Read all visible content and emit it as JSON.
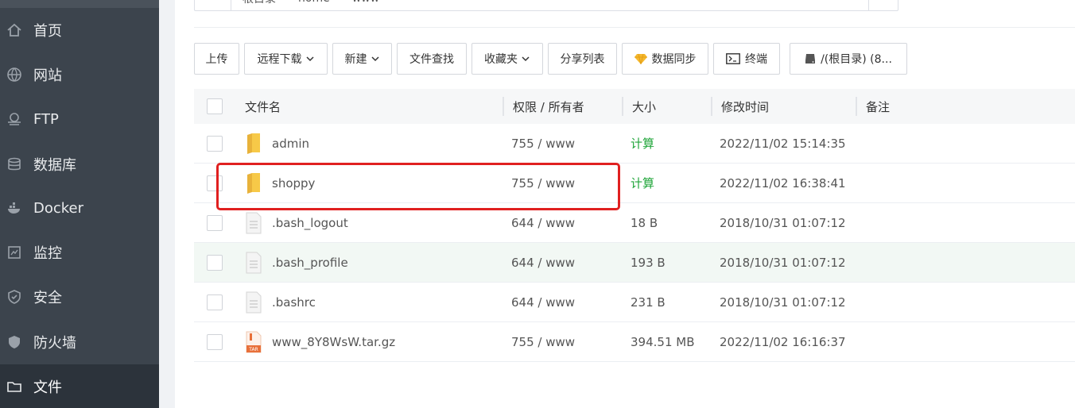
{
  "sidebar": {
    "items": [
      {
        "label": "首页",
        "icon": "home-icon"
      },
      {
        "label": "网站",
        "icon": "globe-icon"
      },
      {
        "label": "FTP",
        "icon": "ftp-icon"
      },
      {
        "label": "数据库",
        "icon": "database-icon"
      },
      {
        "label": "Docker",
        "icon": "docker-icon"
      },
      {
        "label": "监控",
        "icon": "monitor-icon"
      },
      {
        "label": "安全",
        "icon": "shield-icon"
      },
      {
        "label": "防火墙",
        "icon": "firewall-icon"
      },
      {
        "label": "文件",
        "icon": "folder-icon",
        "active": true
      }
    ]
  },
  "path": {
    "segments": [
      "根目录",
      "home",
      "www"
    ]
  },
  "toolbar": {
    "upload": "上传",
    "remote_download": "远程下载",
    "new": "新建",
    "file_search": "文件查找",
    "favorites": "收藏夹",
    "share_list": "分享列表",
    "data_sync": "数据同步",
    "terminal": "终端",
    "disk": "/(根目录) (8..."
  },
  "table": {
    "headers": {
      "name": "文件名",
      "perm": "权限 / 所有者",
      "size": "大小",
      "time": "修改时间",
      "note": "备注"
    },
    "rows": [
      {
        "name": "admin",
        "type": "folder",
        "perm": "755 / www",
        "size": "计算",
        "time": "2022/11/02 15:14:35"
      },
      {
        "name": "shoppy",
        "type": "folder",
        "perm": "755 / www",
        "size": "计算",
        "time": "2022/11/02 16:38:41"
      },
      {
        "name": ".bash_logout",
        "type": "file",
        "perm": "644 / www",
        "size": "18 B",
        "time": "2018/10/31 01:07:12"
      },
      {
        "name": ".bash_profile",
        "type": "file",
        "perm": "644 / www",
        "size": "193 B",
        "time": "2018/10/31 01:07:12"
      },
      {
        "name": ".bashrc",
        "type": "file",
        "perm": "644 / www",
        "size": "231 B",
        "time": "2018/10/31 01:07:12"
      },
      {
        "name": "www_8Y8WsW.tar.gz",
        "type": "archive",
        "perm": "755 / www",
        "size": "394.51 MB",
        "time": "2022/11/02 16:16:37"
      }
    ]
  },
  "archive_badge": "TAR",
  "colors": {
    "sidebar_bg": "#3c444d",
    "accent_green": "#20a53a",
    "highlight_red": "#e02020",
    "folder_yellow": "#f7c948"
  }
}
